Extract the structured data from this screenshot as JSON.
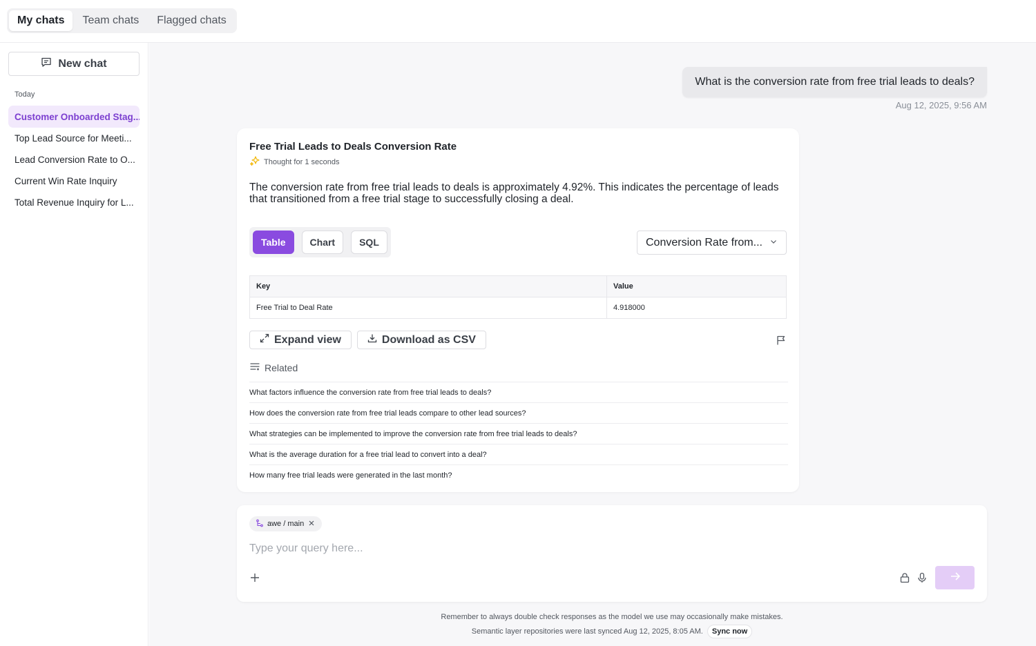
{
  "tabs": [
    {
      "label": "My chats",
      "active": true
    },
    {
      "label": "Team chats",
      "active": false
    },
    {
      "label": "Flagged chats",
      "active": false
    }
  ],
  "sidebar": {
    "new_chat_label": "New chat",
    "section_label": "Today",
    "items": [
      {
        "label": "Customer Onboarded Stag...",
        "active": true
      },
      {
        "label": "Top Lead Source for Meeti...",
        "active": false
      },
      {
        "label": "Lead Conversion Rate to O...",
        "active": false
      },
      {
        "label": "Current Win Rate Inquiry",
        "active": false
      },
      {
        "label": "Total Revenue Inquiry for L...",
        "active": false
      }
    ]
  },
  "conversation": {
    "user_message": "What is the conversion rate from free trial leads to deals?",
    "user_timestamp": "Aug 12, 2025, 9:56 AM",
    "answer": {
      "title": "Free Trial Leads to Deals Conversion Rate",
      "thought_label": "Thought for 1 seconds",
      "body": "The conversion rate from free trial leads to deals is approximately 4.92%. This indicates the percentage of leads that transitioned from a free trial stage to successfully closing a deal.",
      "view_tabs": [
        {
          "label": "Table",
          "active": true
        },
        {
          "label": "Chart",
          "active": false
        },
        {
          "label": "SQL",
          "active": false
        }
      ],
      "dataset_select": "Conversion Rate from...",
      "table": {
        "columns": [
          "Key",
          "Value"
        ],
        "rows": [
          [
            "Free Trial to Deal Rate",
            "4.918000"
          ]
        ]
      },
      "expand_label": "Expand view",
      "download_label": "Download as CSV",
      "related_label": "Related",
      "related": [
        "What factors influence the conversion rate from free trial leads to deals?",
        "How does the conversion rate from free trial leads compare to other lead sources?",
        "What strategies can be implemented to improve the conversion rate from free trial leads to deals?",
        "What is the average duration for a free trial lead to convert into a deal?",
        "How many free trial leads were generated in the last month?"
      ]
    }
  },
  "composer": {
    "repo_chip": "awe / main",
    "placeholder": "Type your query here..."
  },
  "footer": {
    "disclaimer": "Remember to always double check responses as the model we use may occasionally make mistakes.",
    "sync_text": "Semantic layer repositories were last synced Aug 12, 2025, 8:05 AM.",
    "sync_button": "Sync now"
  },
  "colors": {
    "accent": "#8a4be0",
    "accent_light": "#f2e9fc",
    "send_disabled": "#e4cdf7",
    "thought_icon": "#f2b705"
  },
  "icons": [
    "chat-icon",
    "sparkle-icon",
    "chevron-down-icon",
    "expand-icon",
    "download-icon",
    "flag-icon",
    "related-list-icon",
    "branch-icon",
    "close-icon",
    "plus-icon",
    "lock-icon",
    "microphone-icon",
    "arrow-right-icon"
  ]
}
